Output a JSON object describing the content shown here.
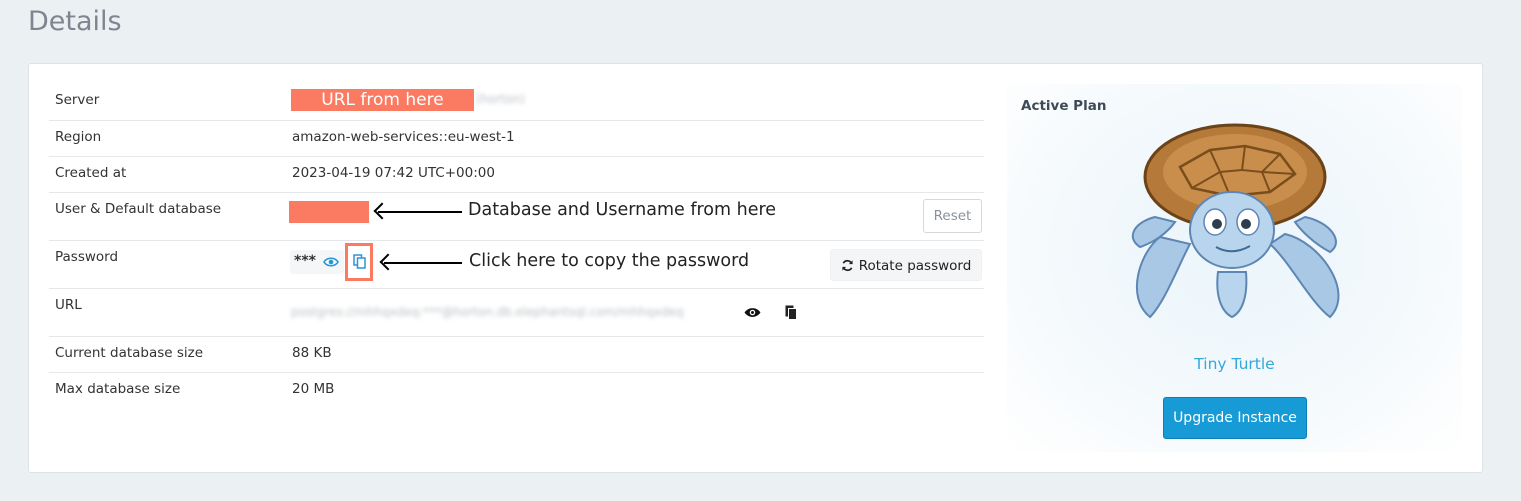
{
  "page": {
    "title": "Details"
  },
  "rows": [
    {
      "label": "Server",
      "redact_text": "URL from here",
      "blurred": "(horton)"
    },
    {
      "label": "Region",
      "value": "amazon-web-services::eu-west-1"
    },
    {
      "label": "Created at",
      "value": "2023-04-19 07:42 UTC+00:00"
    },
    {
      "label": "User & Default database",
      "reset_label": "Reset"
    },
    {
      "label": "Password",
      "masked": "***",
      "rotate_label": "Rotate password"
    },
    {
      "label": "URL",
      "blurred": "postgres://mhhqxdeq:***@horton.db.elephantsql.com/mhhqxdeq"
    },
    {
      "label": "Current database size",
      "value": "88 KB"
    },
    {
      "label": "Max database size",
      "value": "20 MB"
    }
  ],
  "annotations": {
    "db_user": "Database and Username from here",
    "copy_password": "Click here to copy the password"
  },
  "plan": {
    "label": "Active Plan",
    "name": "Tiny Turtle",
    "upgrade_label": "Upgrade Instance"
  },
  "icons": {
    "eye": "eye-icon",
    "copy": "copy-icon",
    "refresh": "refresh-icon",
    "mascot": "turtle-mascot"
  },
  "colors": {
    "highlight": "#fb7a62",
    "accent": "#179bd7",
    "plan_name": "#34a7db"
  }
}
